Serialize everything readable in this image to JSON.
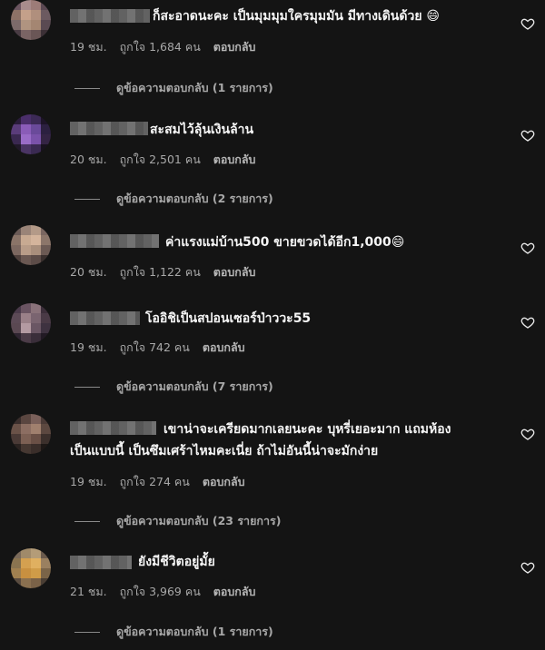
{
  "comments": [
    {
      "text_line1": "ก็สะอาดนะคะ เป็นมุมมุมใครมุมมัน มีทางเดินด้วย 😄",
      "text_line2": "",
      "time": "19 ชม.",
      "likes": "ถูกใจ 1,684 คน",
      "reply": "ตอบกลับ",
      "view_replies": "ดูข้อความตอบกลับ (1 รายการ)",
      "avatar_colors": [
        "#6b5560",
        "#a88c8c",
        "#9c7c78",
        "#5b4852",
        "#8d7266",
        "#c4a08a",
        "#b08f7d",
        "#6c5a60",
        "#7c6a6a",
        "#b09480",
        "#a48672",
        "#5a4a52",
        "#4a3c44",
        "#7a6464",
        "#6a5656",
        "#3c3036"
      ]
    },
    {
      "text_line1": "สะสมไว้ลุ้นเงินล้าน",
      "text_line2": "",
      "time": "20 ชม.",
      "likes": "ถูกใจ 2,501 คน",
      "reply": "ตอบกลับ",
      "view_replies": "ดูข้อความตอบกลับ (2 รายการ)",
      "avatar_colors": [
        "#2a1c3a",
        "#4a2e6a",
        "#3c2a56",
        "#1e1428",
        "#5a3c7a",
        "#8a5cb8",
        "#6a4a9a",
        "#2c2040",
        "#3a2850",
        "#9a6cc8",
        "#7a52aa",
        "#342444",
        "#201828",
        "#4a3464",
        "#3a2a52",
        "#18121e"
      ]
    },
    {
      "text_line1": "ค่าแรงแม่บ้าน500 ขายขวดได้อีก1,000😄",
      "text_line2": "",
      "time": "20 ชม.",
      "likes": "ถูกใจ 1,122 คน",
      "reply": "ตอบกลับ",
      "view_replies": "",
      "avatar_colors": [
        "#6a5a56",
        "#9a8478",
        "#b49a88",
        "#7a6660",
        "#8a7468",
        "#c8aa92",
        "#d4b49c",
        "#8c766a",
        "#7c6860",
        "#b89c88",
        "#a88e7c",
        "#6c5a54",
        "#4e403c",
        "#6a5852",
        "#5c4c48",
        "#3a302e"
      ]
    },
    {
      "text_line1": "โออิชิเป็นสปอนเซอร์ป่าววะ55",
      "text_line2": "",
      "time": "19 ชม.",
      "likes": "ถูกใจ 742 คน",
      "reply": "ตอบกลับ",
      "view_replies": "ดูข้อความตอบกลับ (7 รายการ)",
      "avatar_colors": [
        "#4a3a4a",
        "#6a5462",
        "#8a727a",
        "#3c2e3a",
        "#5c4a56",
        "#9a8088",
        "#7a6470",
        "#4a3a46",
        "#5a4852",
        "#b49aa2",
        "#6a5664",
        "#3e3240",
        "#2e2430",
        "#4c3c48",
        "#3a2e3a",
        "#221a24"
      ]
    },
    {
      "text_line1": "เขาน่าจะเครียดมากเลยนะคะ บุหรี่เยอะมาก แถมห้อง",
      "text_line2": "เป็นแบบนี้ เป็นซึมเศร้าไหมคะเนี่ย ถ้าไม่อันนี้น่าจะมักง่าย",
      "time": "19 ชม.",
      "likes": "ถูกใจ 274 คน",
      "reply": "ตอบกลับ",
      "view_replies": "ดูข้อความตอบกลับ (23 รายการ)",
      "avatar_colors": [
        "#3a2e2c",
        "#5a4640",
        "#7a605a",
        "#4a3a36",
        "#6a5248",
        "#8c6e62",
        "#a0806e",
        "#5c4840",
        "#4a3a36",
        "#7c6054",
        "#6a5046",
        "#3c302c",
        "#2a2220",
        "#463832",
        "#3a2e2a",
        "#1e1816"
      ]
    },
    {
      "text_line1": "ยังมีชีวิตอยู่มั้ย",
      "text_line2": "",
      "time": "21 ชม.",
      "likes": "ถูกใจ 3,969 คน",
      "reply": "ตอบกลับ",
      "view_replies": "ดูข้อความตอบกลับ (1 รายการ)",
      "avatar_colors": [
        "#7a6a5a",
        "#a08a6a",
        "#b49c78",
        "#6a5a4c",
        "#8a7450",
        "#d4a050",
        "#e0b060",
        "#9a8060",
        "#a08050",
        "#c89040",
        "#d09c48",
        "#7a6448",
        "#5a4c40",
        "#8a7050",
        "#7a6248",
        "#4a3e34"
      ]
    }
  ]
}
